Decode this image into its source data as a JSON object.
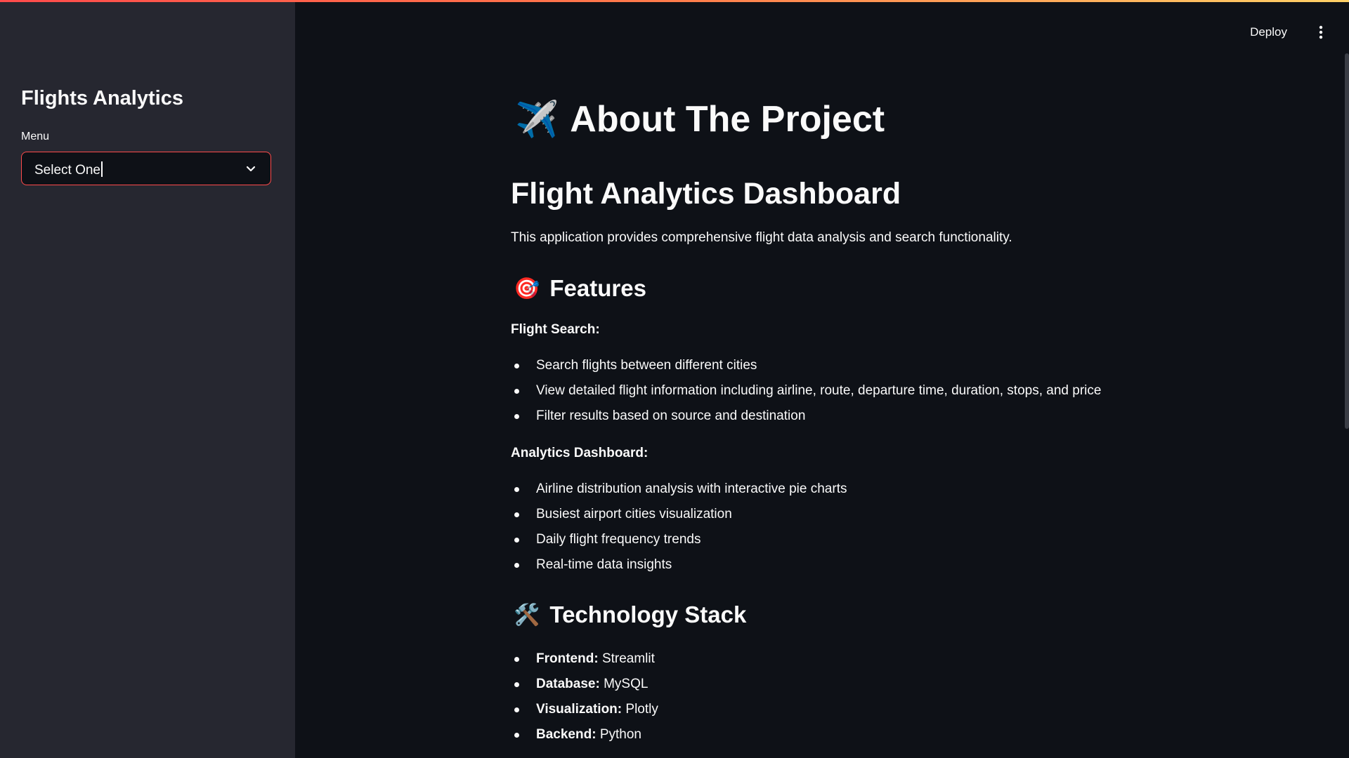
{
  "app": {
    "deploy_label": "Deploy"
  },
  "sidebar": {
    "title": "Flights Analytics",
    "menu_label": "Menu",
    "select_value": "Select One"
  },
  "main": {
    "title_icon": "✈️",
    "title": "About The Project",
    "subtitle": "Flight Analytics Dashboard",
    "intro": "This application provides comprehensive flight data analysis and search functionality.",
    "features": {
      "icon": "🎯",
      "heading": "Features",
      "flight_search": {
        "label": "Flight Search:",
        "items": [
          "Search flights between different cities",
          "View detailed flight information including airline, route, departure time, duration, stops, and price",
          "Filter results based on source and destination"
        ]
      },
      "analytics": {
        "label": "Analytics Dashboard:",
        "items": [
          "Airline distribution analysis with interactive pie charts",
          "Busiest airport cities visualization",
          "Daily flight frequency trends",
          "Real-time data insights"
        ]
      }
    },
    "tech": {
      "icon": "🛠️",
      "heading": "Technology Stack",
      "items": [
        {
          "key": "Frontend:",
          "value": "Streamlit"
        },
        {
          "key": "Database:",
          "value": "MySQL"
        },
        {
          "key": "Visualization:",
          "value": "Plotly"
        },
        {
          "key": "Backend:",
          "value": "Python"
        }
      ]
    }
  },
  "colors": {
    "background": "#0e1117",
    "sidebar": "#262730",
    "accent": "#ff4b4b",
    "text": "#fafafa"
  }
}
